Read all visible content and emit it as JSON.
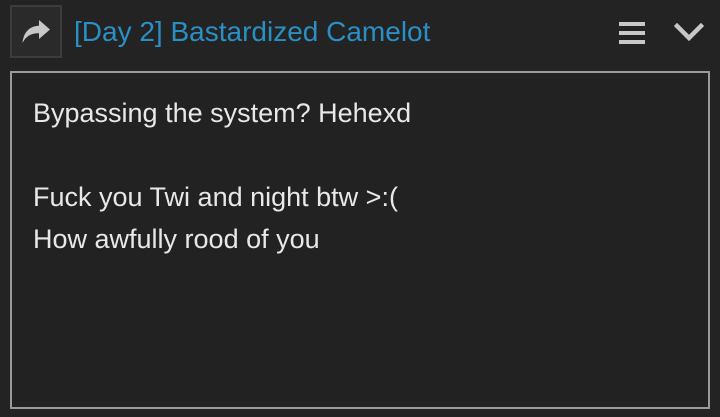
{
  "header": {
    "title": "[Day 2] Bastardized Camelot",
    "icons": {
      "share": "share-arrow-icon",
      "menu": "hamburger-menu-icon",
      "collapse": "chevron-down-icon"
    }
  },
  "post": {
    "lines": [
      "Bypassing the system? Hehexd",
      "",
      "Fuck you Twi and night btw >:(",
      "How awfully rood of you"
    ]
  },
  "colors": {
    "background": "#232323",
    "title": "#2a8fc4",
    "text": "#e8e8e8",
    "icon": "#c8c8c8",
    "box_border": "#9a9a9a"
  }
}
